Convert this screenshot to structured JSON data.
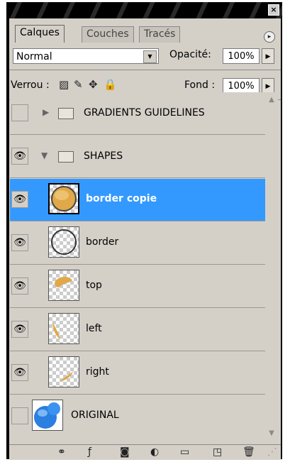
{
  "window": {
    "close_label": "×"
  },
  "tabs": [
    {
      "label": "Calques",
      "active": true
    },
    {
      "label": "Couches",
      "active": false
    },
    {
      "label": "Tracés",
      "active": false
    }
  ],
  "panel_menu_label": "▸",
  "blend_mode": {
    "value": "Normal"
  },
  "opacity": {
    "label": "Opacité:",
    "value": "100%"
  },
  "lock": {
    "label": "Verrou :"
  },
  "fill": {
    "label": "Fond :",
    "value": "100%"
  },
  "layers": [
    {
      "name": "GRADIENTS GUIDELINES",
      "type": "group",
      "visible": false,
      "expanded": false
    },
    {
      "name": "SHAPES",
      "type": "group",
      "visible": true,
      "expanded": true
    },
    {
      "name": "border copie",
      "type": "layer",
      "visible": true,
      "selected": true,
      "thumb": "orange-circle"
    },
    {
      "name": "border",
      "type": "layer",
      "visible": true,
      "thumb": "circle-outline"
    },
    {
      "name": "top",
      "type": "layer",
      "visible": true,
      "thumb": "orange-blob-top"
    },
    {
      "name": "left",
      "type": "layer",
      "visible": true,
      "thumb": "orange-blob-left"
    },
    {
      "name": "right",
      "type": "layer",
      "visible": true,
      "thumb": "orange-blob-right"
    },
    {
      "name": "ORIGINAL",
      "type": "layer",
      "visible": false,
      "thumb": "blue-bubbles"
    }
  ],
  "bottom_icons": [
    "link-icon",
    "fx-icon",
    "mask-icon",
    "adjustment-icon",
    "new-group-icon",
    "new-layer-icon",
    "trash-icon"
  ],
  "colors": {
    "selected": "#3399ff",
    "panel_bg": "#d4d0c8",
    "orange": "#e0a848",
    "blue": "#2a7fe0"
  }
}
